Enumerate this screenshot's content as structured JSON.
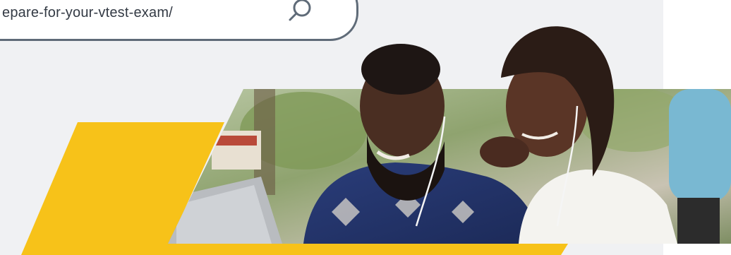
{
  "address_bar": {
    "url_text": "epare-for-your-vtest-exam/"
  },
  "icons": {
    "search": "search-icon"
  },
  "colors": {
    "accent_yellow": "#f7c219",
    "panel_background": "#f0f1f3",
    "bar_border": "#5f6b78"
  }
}
